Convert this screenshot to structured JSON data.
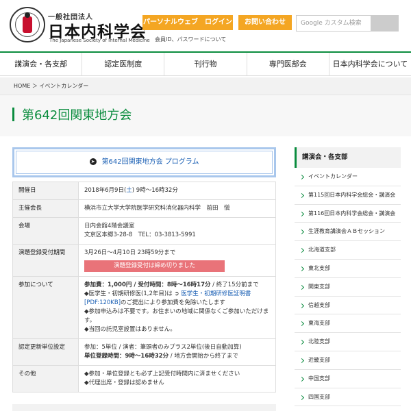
{
  "header": {
    "logo_small": "一般社団法人",
    "logo_name": "日本内科学会",
    "logo_en": "The Japanese Society of Internal Medicine",
    "login_label": "パーソナルウェブ　ログイン",
    "contact_label": "お問い合わせ",
    "login_note": "会員ID、パスワードについて",
    "search_placeholder": "Google カスタム検索"
  },
  "nav": [
    "講演会・各支部",
    "認定医制度",
    "刊行物",
    "専門医部会",
    "日本内科学会について"
  ],
  "breadcrumb": "HOME ＞ イベントカレンダー",
  "page_title": "第642回関東地方会",
  "program_link": "第642回関東地方会 プログラム",
  "table": {
    "date_label": "開催日",
    "date_value_a": "2018年6月9日(",
    "date_value_day": "土",
    "date_value_b": ") 9時〜16時32分",
    "chair_label": "主催会長",
    "chair_value": "横浜市立大学大学院医学研究科消化器内科学　前田　愼",
    "venue_label": "会場",
    "venue_line1": "日内会館4階会議室",
    "venue_line2": "文京区本郷3-28-8　TEL：03-3813-5991",
    "reg_label": "演題登録受付期間",
    "reg_value": "3月26日〜4月10日 23時59分まで",
    "reg_closed": "演題登録受付は締め切りました",
    "join_label": "参加について",
    "join_fee": "参加費：1,000円 / 受付時間：8時〜16時17分",
    "join_fee_tail": " / 終了15分前まで",
    "join_student_a": "◆医学生・初期研修医(1,2年目)は ➲ ",
    "join_student_link": "医学生・初期研修医証明書[PDF:120KB]",
    "join_student_b": "のご提出により参加費を免除いたします",
    "join_note": "◆参加申込みは不要です。お住まいの地域に関係なくご参加いただけます。",
    "join_nursery": "◆当回の託児室設置はありません。",
    "credit_label": "認定更新単位設定",
    "credit_line1": "参加：5単位 / 演者：筆頭者のみプラス2単位(後日自動加算)",
    "credit_line2_bold": "単位登録時間：9時〜16時32分",
    "credit_line2_tail": " / 地方会開始から終了まで",
    "other_label": "その他",
    "other_line1": "◆参加・単位登録とも必ず上記受付時間内に済ませください",
    "other_line2": "◆代理出席・登録は認めません"
  },
  "sidebar": {
    "heading": "講演会・各支部",
    "items": [
      "イベントカレンダー",
      "第115回日本内科学会総会・講演会",
      "第116回日本内科学会総会・講演会",
      "生涯教育講演会ＡＢセッション",
      "北海道支部",
      "東北支部",
      "関東支部",
      "信越支部",
      "東海支部",
      "北陸支部",
      "近畿支部",
      "中国支部",
      "四国支部"
    ]
  },
  "colors": {
    "accent": "#0a8c3e",
    "button": "#f4a623",
    "closed": "#e97379",
    "link": "#1a5fb4"
  }
}
